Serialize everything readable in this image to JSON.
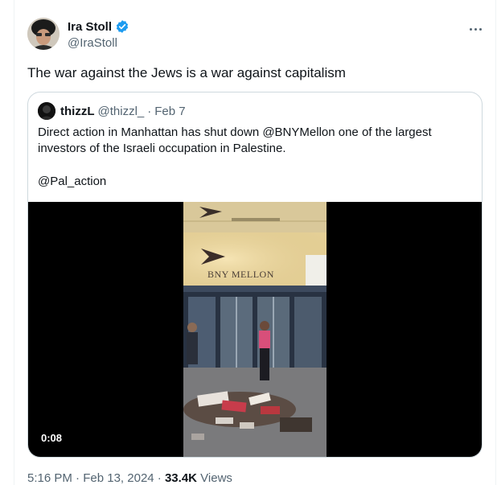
{
  "author": {
    "display_name": "Ira Stoll",
    "handle": "@IraStoll",
    "verified": true
  },
  "tweet": {
    "text": "The war against the Jews is a war against capitalism"
  },
  "quoted_tweet": {
    "display_name": "thizzL",
    "handle": "@thizzl_",
    "separator": "·",
    "date": "Feb 7",
    "text": "Direct action in Manhattan has shut down @BNYMellon one of the largest investors of the Israeli occupation in Palestine.",
    "mention_line": "@Pal_action",
    "video": {
      "duration": "0:08",
      "sign_text": "BNY MELLON"
    }
  },
  "footer": {
    "time": "5:16 PM",
    "separator": "·",
    "date": "Feb 13, 2024",
    "views_count": "33.4K",
    "views_label": "Views"
  },
  "colors": {
    "verified_blue": "#1d9bf0",
    "text_primary": "#0f1419",
    "text_secondary": "#536471",
    "border": "#cfd9de"
  }
}
